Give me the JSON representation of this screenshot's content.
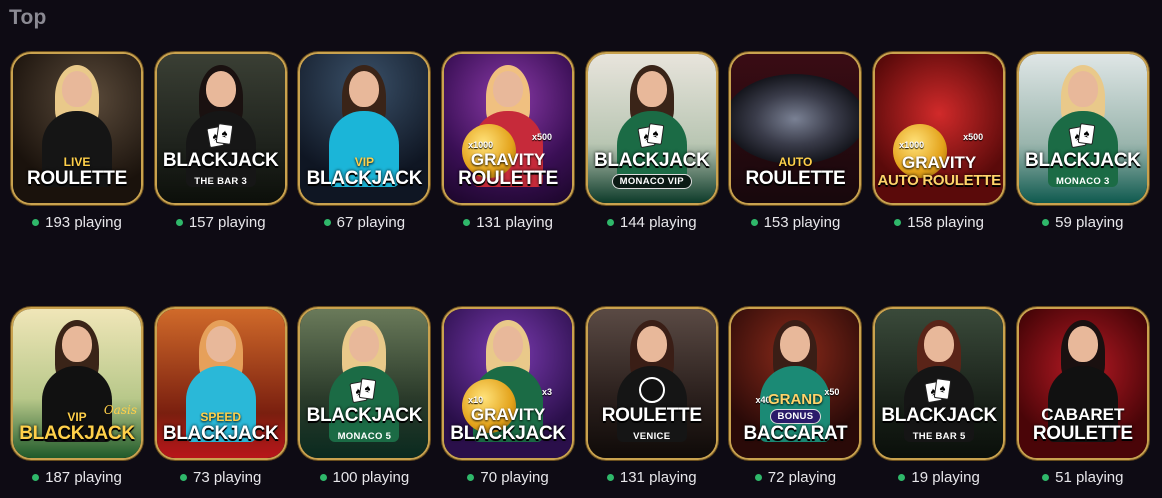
{
  "section": {
    "title": "Top"
  },
  "accent": "#c9a24f",
  "status_dot_color": "#2fb86a",
  "games": [
    {
      "top": "LIVE",
      "main": "ROULETTE",
      "sub": "",
      "players": "193 playing",
      "theme": "roulette-live"
    },
    {
      "top": "",
      "main": "BLACKJACK",
      "sub": "THE BAR 3",
      "players": "157 playing",
      "theme": "bar"
    },
    {
      "top": "VIP",
      "main": "BLACKJACK",
      "sub": "",
      "players": "67 playing",
      "theme": "vip"
    },
    {
      "top": "GRAVITY",
      "main": "ROULETTE",
      "sub": "",
      "players": "131 playing",
      "theme": "gravity-purple",
      "mult1": "x1000",
      "mult2": "x500"
    },
    {
      "top": "",
      "main": "BLACKJACK",
      "sub": "MONACO VIP",
      "players": "144 playing",
      "theme": "monaco-vip"
    },
    {
      "top": "AUTO",
      "main": "ROULETTE",
      "sub": "",
      "players": "153 playing",
      "theme": "auto"
    },
    {
      "top": "GRAVITY",
      "main": "AUTO ROULETTE",
      "sub": "",
      "players": "158 playing",
      "theme": "gravity-red",
      "mult1": "x1000",
      "mult2": "x500"
    },
    {
      "top": "",
      "main": "BLACKJACK",
      "sub": "MONACO 3",
      "players": "59 playing",
      "theme": "monaco3"
    },
    {
      "top": "VIP",
      "main": "BLACKJACK",
      "sub": "",
      "script": "Oasis",
      "players": "187 playing",
      "theme": "oasis"
    },
    {
      "top": "SPEED",
      "main": "BLACKJACK",
      "sub": "",
      "players": "73 playing",
      "theme": "speed"
    },
    {
      "top": "",
      "main": "BLACKJACK",
      "sub": "MONACO 5",
      "players": "100 playing",
      "theme": "monaco5"
    },
    {
      "top": "GRAVITY",
      "main": "BLACKJACK",
      "sub": "",
      "players": "70 playing",
      "theme": "gravity-bj",
      "mult1": "x10",
      "mult2": "x3"
    },
    {
      "top": "",
      "main": "ROULETTE",
      "sub": "VENICE",
      "players": "131 playing",
      "theme": "venice"
    },
    {
      "top": "GRAND",
      "main": "BACCARAT",
      "sub": "BONUS",
      "players": "72 playing",
      "theme": "baccarat",
      "mult1": "x40",
      "mult2": "x50"
    },
    {
      "top": "",
      "main": "BLACKJACK",
      "sub": "THE BAR 5",
      "players": "19 playing",
      "theme": "bar5"
    },
    {
      "top": "CABARET",
      "main": "ROULETTE",
      "sub": "",
      "players": "51 playing",
      "theme": "cabaret"
    }
  ]
}
